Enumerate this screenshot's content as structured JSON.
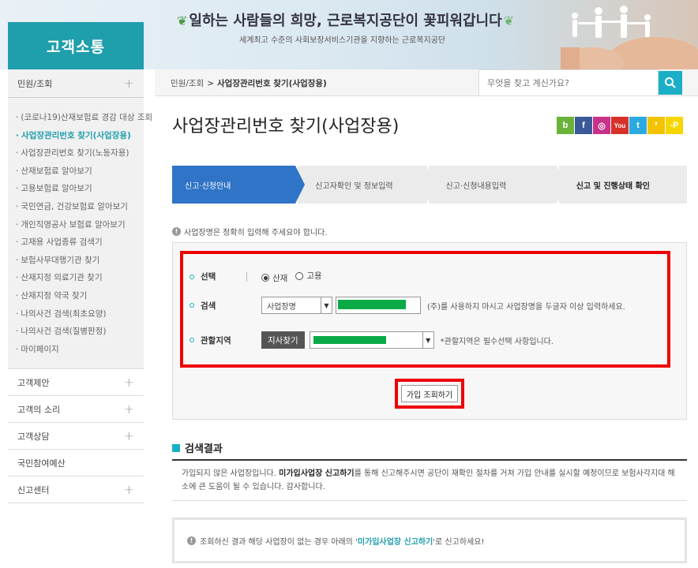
{
  "banner": {
    "section_title": "고객소통",
    "slogan": "일하는 사람들의 희망, 근로복지공단이 꽃피워갑니다",
    "subslogan": "세계최고 수준의 사회보장서비스기관을 지향하는 근로복지공단"
  },
  "sidebar": {
    "head": "민원/조회",
    "sub_items": [
      {
        "label": "(코로나19)산재보험료 경감 대상 조회",
        "active": false
      },
      {
        "label": "사업장관리번호 찾기(사업장용)",
        "active": true
      },
      {
        "label": "사업장관리번호 찾기(노동자용)",
        "active": false
      },
      {
        "label": "산재보험료 알아보기",
        "active": false
      },
      {
        "label": "고용보험료 알아보기",
        "active": false
      },
      {
        "label": "국민연금, 건강보험료 알아보기",
        "active": false
      },
      {
        "label": "개인직영공사 보험료 알아보기",
        "active": false
      },
      {
        "label": "고재용 사업종류 검색기",
        "active": false
      },
      {
        "label": "보험사무대행기관 찾기",
        "active": false
      },
      {
        "label": "산재지정 의료기관 찾기",
        "active": false
      },
      {
        "label": "산재지정 약국 찾기",
        "active": false
      },
      {
        "label": "나의사건 검색(최초요양)",
        "active": false
      },
      {
        "label": "나의사건 검색(질병판정)",
        "active": false
      },
      {
        "label": "마이페이지",
        "active": false
      }
    ],
    "menu": [
      {
        "label": "고객제안",
        "expandable": true
      },
      {
        "label": "고객의 소리",
        "expandable": true
      },
      {
        "label": "고객상담",
        "expandable": true
      },
      {
        "label": "국민참여예산",
        "expandable": false
      },
      {
        "label": "신고센터",
        "expandable": true
      }
    ]
  },
  "topbar": {
    "crumb_parent": "민원/조회",
    "crumb_separator": ">",
    "crumb_current": "사업장관리번호 찾기(사업장용)",
    "search_placeholder": "무엇을 찾고 계신가요?"
  },
  "page": {
    "title": "사업장관리번호 찾기(사업장용)",
    "sns": [
      {
        "name": "blog",
        "glyph": "b",
        "color": "#6ab23a"
      },
      {
        "name": "facebook",
        "glyph": "f",
        "color": "#3b5998"
      },
      {
        "name": "instagram",
        "glyph": "◎",
        "color": "#c8328b"
      },
      {
        "name": "youtube",
        "glyph": "You",
        "color": "#d6322a"
      },
      {
        "name": "twitter",
        "glyph": "t",
        "color": "#2ba9e1"
      },
      {
        "name": "kakaostory",
        "glyph": "❜",
        "color": "#f4c300"
      },
      {
        "name": "kakaotalk",
        "glyph": "-P",
        "color": "#f6d600"
      }
    ]
  },
  "steps": [
    {
      "label": "신고·신청안내",
      "active": true
    },
    {
      "label": "신고자확인 및 정보입력",
      "active": false
    },
    {
      "label": "신고·신청내용입력",
      "active": false
    },
    {
      "label": "신고 및 진행상태 확인",
      "active": false
    }
  ],
  "info": "사업장명은 정확히 입력해 주세요야 합니다.",
  "form": {
    "select_label": "선택",
    "radio_options": [
      {
        "label": "산재",
        "checked": true
      },
      {
        "label": "고용",
        "checked": false
      }
    ],
    "search_label": "검색",
    "search_type": "사업장명",
    "search_hint": "(주)를 사용하지 마시고 사업장명을 두글자 이상 입력하세요.",
    "region_label": "관할지역",
    "branch_button": "지사찾기",
    "region_hint": "*관할지역은 필수선택 사항입니다.",
    "submit_label": "가입 조회하기"
  },
  "result": {
    "title": "검색결과",
    "text_before": "가입되지 않은 사업장입니다. ",
    "text_bold": "미가입사업장 신고하기",
    "text_after": "를 통해 신고해주시면 공단이 재확인 절차를 거쳐 가입 안내를 실시할 예정이므로 보험사각지대 해소에 큰 도움이 될 수 있습니다. 감사합니다."
  },
  "notice": {
    "before": "조회하신 결과 해당 사업장이 없는 경우 아래의 '",
    "link": "미가입사업장 신고하기",
    "after": "'로 신고하세요!"
  }
}
